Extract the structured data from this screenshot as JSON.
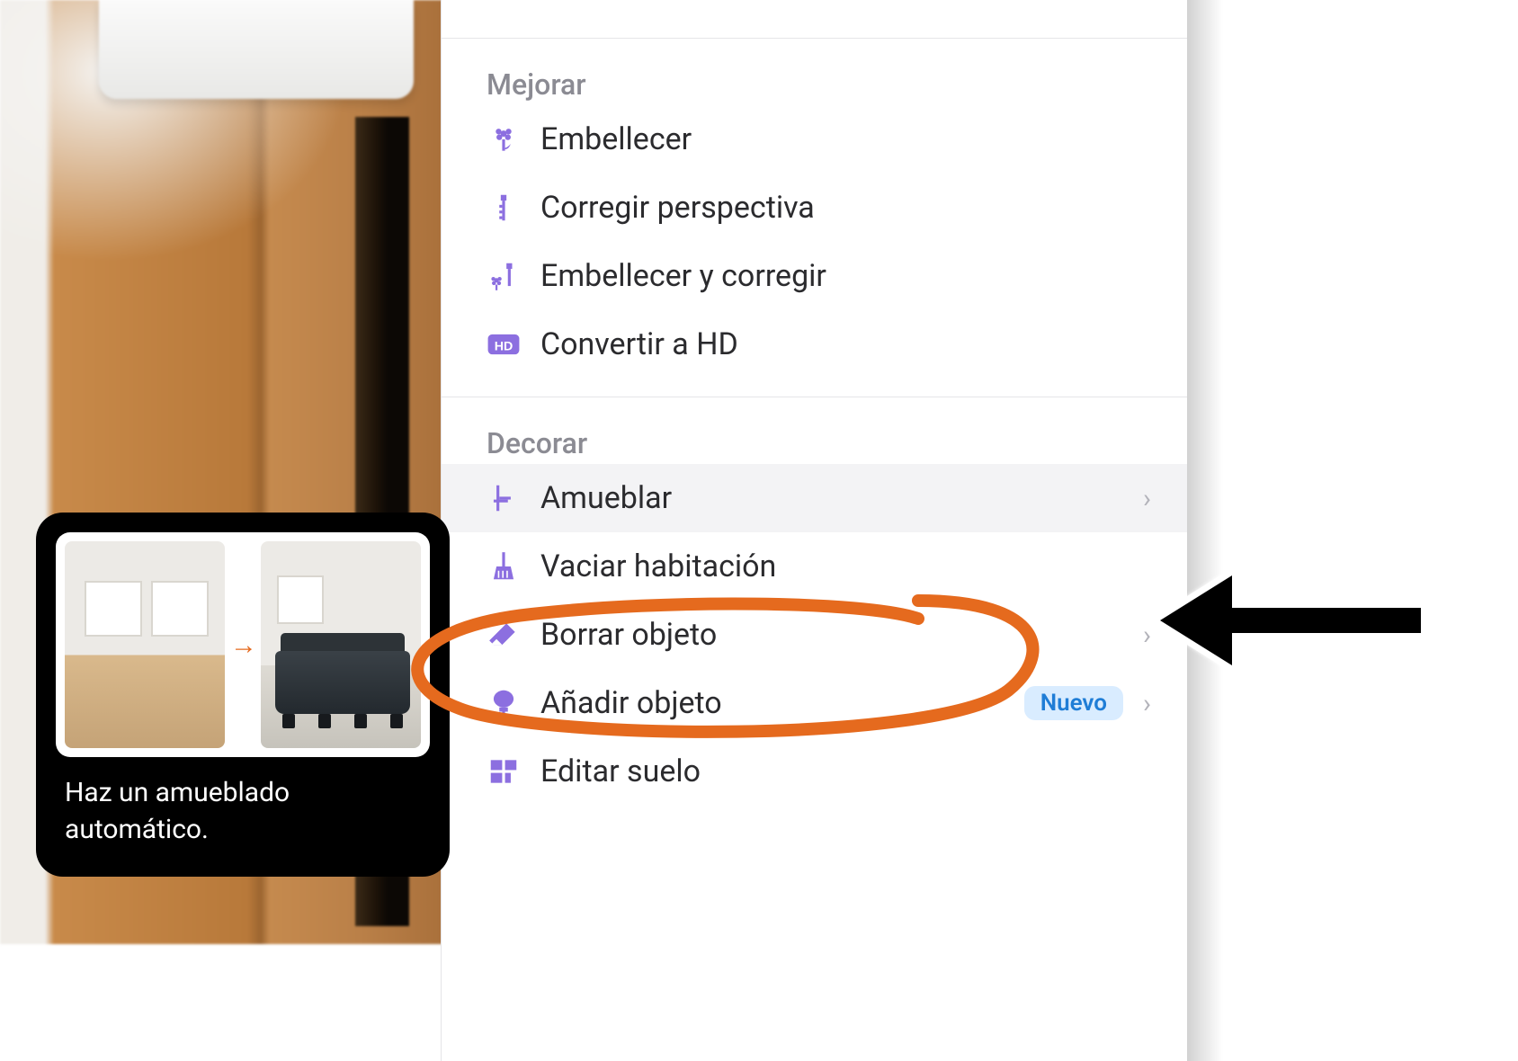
{
  "tooltip": {
    "text": "Haz un amueblado automático.",
    "arrow_glyph": "→"
  },
  "panel": {
    "sections": {
      "mejorar": {
        "title": "Mejorar",
        "items": [
          {
            "icon": "flower-icon",
            "label": "Embellecer"
          },
          {
            "icon": "ruler-icon",
            "label": "Corregir perspectiva"
          },
          {
            "icon": "flower-ruler-icon",
            "label": "Embellecer y corregir"
          },
          {
            "icon": "hd-icon",
            "label": "Convertir a HD"
          }
        ]
      },
      "decorar": {
        "title": "Decorar",
        "items": [
          {
            "icon": "chair-icon",
            "label": "Amueblar",
            "chevron": "›",
            "hover": true
          },
          {
            "icon": "broom-icon",
            "label": "Vaciar habitación"
          },
          {
            "icon": "eraser-icon",
            "label": "Borrar objeto",
            "chevron": "›"
          },
          {
            "icon": "add-shape-icon",
            "label": "Añadir objeto",
            "badge": "Nuevo",
            "chevron": "›"
          },
          {
            "icon": "floor-icon",
            "label": "Editar suelo"
          }
        ]
      }
    }
  },
  "colors": {
    "accent_purple": "#8c6fe0",
    "annotation_orange": "#e56a1e",
    "badge_bg": "#d9ecff",
    "badge_fg": "#1f7dd6"
  }
}
